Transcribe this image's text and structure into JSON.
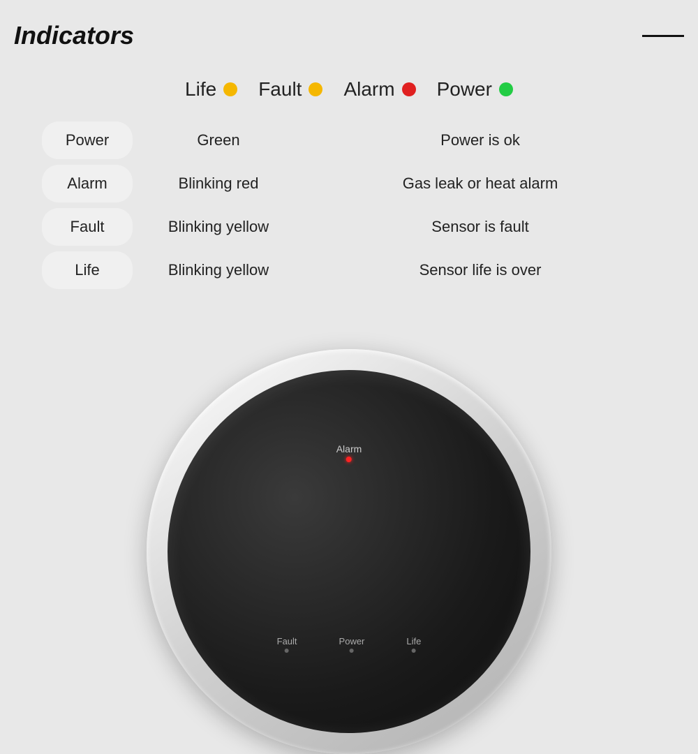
{
  "header": {
    "title": "Indicators",
    "line": true
  },
  "legend": {
    "items": [
      {
        "label": "Life",
        "dot_color": "yellow"
      },
      {
        "label": "Fault",
        "dot_color": "yellow"
      },
      {
        "label": "Alarm",
        "dot_color": "red"
      },
      {
        "label": "Power",
        "dot_color": "green"
      }
    ]
  },
  "table": {
    "rows": [
      {
        "col1": "Power",
        "col2": "Green",
        "col3": "Power is ok"
      },
      {
        "col1": "Alarm",
        "col2": "Blinking red",
        "col3": "Gas leak or heat alarm"
      },
      {
        "col1": "Fault",
        "col2": "Blinking yellow",
        "col3": "Sensor is fault"
      },
      {
        "col1": "Life",
        "col2": "Blinking yellow",
        "col3": "Sensor life is over"
      }
    ]
  },
  "device": {
    "labels": {
      "alarm": "Alarm",
      "fault": "Fault",
      "power": "Power",
      "life": "Life"
    }
  }
}
